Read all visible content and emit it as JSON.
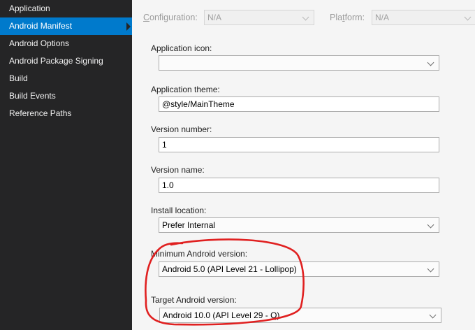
{
  "sidebar": {
    "items": [
      {
        "label": "Application",
        "selected": false
      },
      {
        "label": "Android Manifest",
        "selected": true
      },
      {
        "label": "Android Options",
        "selected": false
      },
      {
        "label": "Android Package Signing",
        "selected": false
      },
      {
        "label": "Build",
        "selected": false
      },
      {
        "label": "Build Events",
        "selected": false
      },
      {
        "label": "Reference Paths",
        "selected": false
      }
    ]
  },
  "topbar": {
    "configuration_label_first": "C",
    "configuration_label_rest": "onfiguration:",
    "configuration_value": "N/A",
    "platform_label_first": "Pla",
    "platform_label_underlined": "t",
    "platform_label_rest": "form:",
    "platform_value": "N/A"
  },
  "form": {
    "app_icon": {
      "label": "Application icon:",
      "value": ""
    },
    "app_theme": {
      "label": "Application theme:",
      "value": "@style/MainTheme"
    },
    "version_number": {
      "label": "Version number:",
      "value": "1"
    },
    "version_name": {
      "label": "Version name:",
      "value": "1.0"
    },
    "install_location": {
      "label": "Install location:",
      "value": "Prefer Internal"
    },
    "min_android": {
      "label": "Minimum Android version:",
      "value": "Android 5.0 (API Level 21 - Lollipop)"
    },
    "target_android": {
      "label": "Target Android version:",
      "value": "Android 10.0 (API Level 29 - Q)"
    }
  },
  "colors": {
    "sidebar_bg": "#252526",
    "selected_bg": "#007acc",
    "annotation": "#e02020"
  }
}
